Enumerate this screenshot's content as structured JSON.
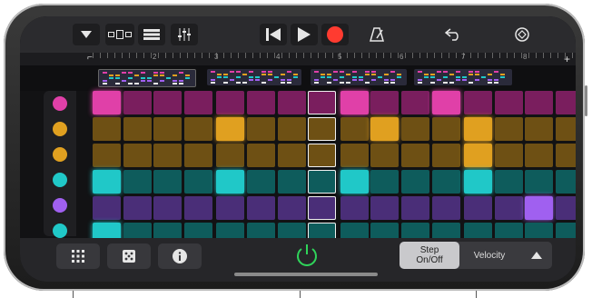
{
  "toolbar": {
    "icons": [
      "dropdown-icon",
      "view-toggle-icon",
      "tracks-icon",
      "mixer-icon",
      "rewind-icon",
      "play-icon",
      "record-icon",
      "metronome-icon",
      "undo-icon",
      "settings-icon"
    ]
  },
  "ruler": {
    "bars": [
      "2",
      "3",
      "4",
      "5",
      "6",
      "7",
      "8"
    ],
    "add_label": "+"
  },
  "instruments": [
    {
      "name": "kick-drum-icon",
      "color": "#e040a8"
    },
    {
      "name": "snare-drum-icon",
      "color": "#e0a020"
    },
    {
      "name": "hand-clap-icon",
      "color": "#e0a020"
    },
    {
      "name": "hi-hat-icon",
      "color": "#20c8c8"
    },
    {
      "name": "tag-icon",
      "color": "#a060f0"
    },
    {
      "name": "cymbal-icon",
      "color": "#20c8c8"
    }
  ],
  "bottom": {
    "buttons": [
      "grid-icon",
      "dice-icon",
      "info-icon"
    ],
    "power_icon": "power-icon",
    "step_label": "Step\nOn/Off",
    "velocity_label": "Velocity",
    "up_icon": "triangle-up-icon"
  },
  "colors": {
    "pink": "#e040a8",
    "gold": "#e0a020",
    "teal": "#20c8c8",
    "purple": "#a060f0",
    "power_green": "#2fd45a",
    "record_red": "#ff3b30"
  }
}
